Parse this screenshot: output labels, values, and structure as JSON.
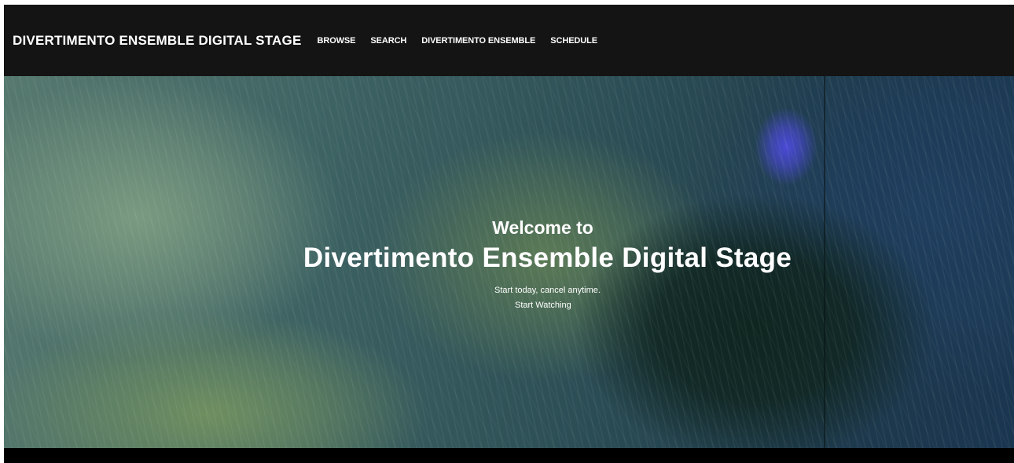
{
  "nav": {
    "brand": "DIVERTIMENTO ENSEMBLE DIGITAL STAGE",
    "links": [
      {
        "label": "BROWSE"
      },
      {
        "label": "SEARCH"
      },
      {
        "label": "DIVERTIMENTO ENSEMBLE"
      },
      {
        "label": "SCHEDULE"
      }
    ]
  },
  "hero": {
    "welcome": "Welcome to",
    "title": "Divertimento Ensemble Digital Stage",
    "tagline": "Start today, cancel anytime.",
    "cta_label": "Start Watching"
  },
  "colors": {
    "nav_background": "#141414",
    "text": "#ffffff",
    "footer": "#000000"
  }
}
